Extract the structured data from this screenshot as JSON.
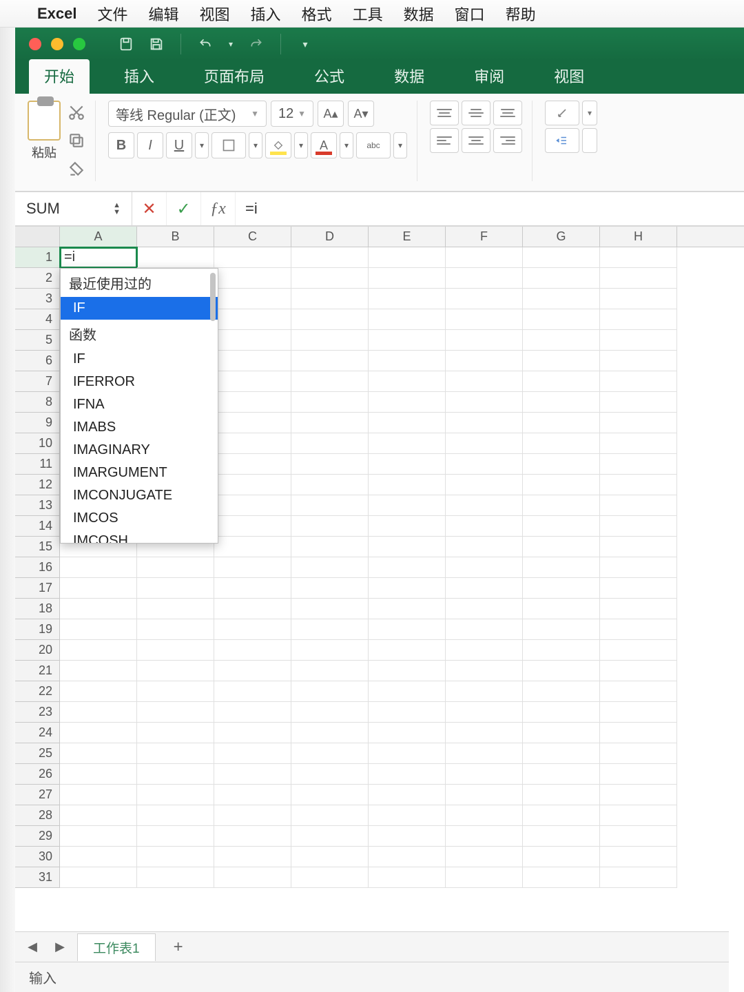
{
  "macMenu": {
    "app": "Excel",
    "items": [
      "文件",
      "编辑",
      "视图",
      "插入",
      "格式",
      "工具",
      "数据",
      "窗口",
      "帮助"
    ]
  },
  "ribbonTabs": [
    "开始",
    "插入",
    "页面布局",
    "公式",
    "数据",
    "审阅",
    "视图"
  ],
  "activeTab": "开始",
  "paste": {
    "label": "粘贴"
  },
  "font": {
    "name": "等线 Regular (正文)",
    "size": "12"
  },
  "nameBox": "SUM",
  "formula": "=i",
  "activeCell": {
    "ref": "A1",
    "value": "=i"
  },
  "columns": [
    "A",
    "B",
    "C",
    "D",
    "E",
    "F",
    "G",
    "H"
  ],
  "rowCount": 31,
  "autocomplete": {
    "recentLabel": "最近使用过的",
    "recent": [
      "IF"
    ],
    "functionsLabel": "函数",
    "functions": [
      "IF",
      "IFERROR",
      "IFNA",
      "IMABS",
      "IMAGINARY",
      "IMARGUMENT",
      "IMCONJUGATE",
      "IMCOS",
      "IMCOSH"
    ],
    "selected": "IF"
  },
  "sheet": {
    "name": "工作表1"
  },
  "status": "输入"
}
